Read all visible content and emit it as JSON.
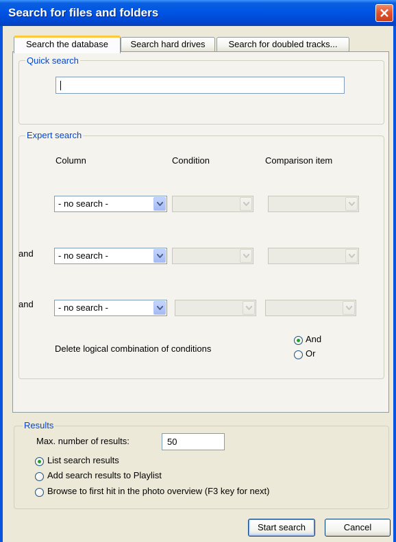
{
  "window": {
    "title": "Search for files and folders"
  },
  "tabs": [
    "Search the database",
    "Search hard drives",
    "Search for doubled tracks..."
  ],
  "quick_search": {
    "legend": "Quick search",
    "value": ""
  },
  "expert_search": {
    "legend": "Expert search",
    "headers": {
      "column": "Column",
      "condition": "Condition",
      "comparison": "Comparison item"
    },
    "rows": [
      {
        "connector": "",
        "column": "- no search -"
      },
      {
        "connector": "and",
        "column": "- no search -"
      },
      {
        "connector": "and",
        "column": "- no search -"
      }
    ],
    "logic_label": "Delete logical combination of conditions",
    "logic_options": [
      "And",
      "Or"
    ],
    "logic_selected": "And"
  },
  "results": {
    "legend": "Results",
    "max_label": "Max. number of results:",
    "max_value": "50",
    "options": [
      "List search results",
      "Add search results to Playlist",
      "Browse to first hit in the photo overview (F3 key for next)"
    ],
    "selected_index": 0
  },
  "buttons": {
    "start": "Start search",
    "cancel": "Cancel"
  }
}
